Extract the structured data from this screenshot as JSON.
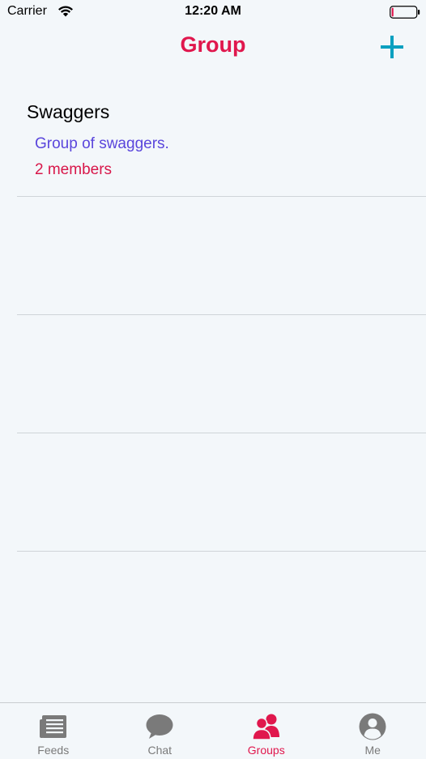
{
  "status_bar": {
    "carrier": "Carrier",
    "time": "12:20 AM",
    "wifi_icon": "wifi-icon",
    "battery_icon": "battery-low-icon"
  },
  "nav": {
    "title": "Group",
    "add_icon": "plus-icon"
  },
  "groups": [
    {
      "name": "Swaggers",
      "description": "Group of swaggers.",
      "members": "2 members"
    }
  ],
  "tabs": [
    {
      "label": "Feeds",
      "icon": "newspaper-icon",
      "active": false
    },
    {
      "label": "Chat",
      "icon": "chat-bubble-icon",
      "active": false
    },
    {
      "label": "Groups",
      "icon": "users-icon",
      "active": true
    },
    {
      "label": "Me",
      "icon": "user-circle-icon",
      "active": false
    }
  ],
  "colors": {
    "accent": "#e0174d",
    "add_button": "#0aa0c0",
    "description": "#5a46dc",
    "inactive_tab": "#7a7a7a",
    "background": "#f3f7fa"
  }
}
